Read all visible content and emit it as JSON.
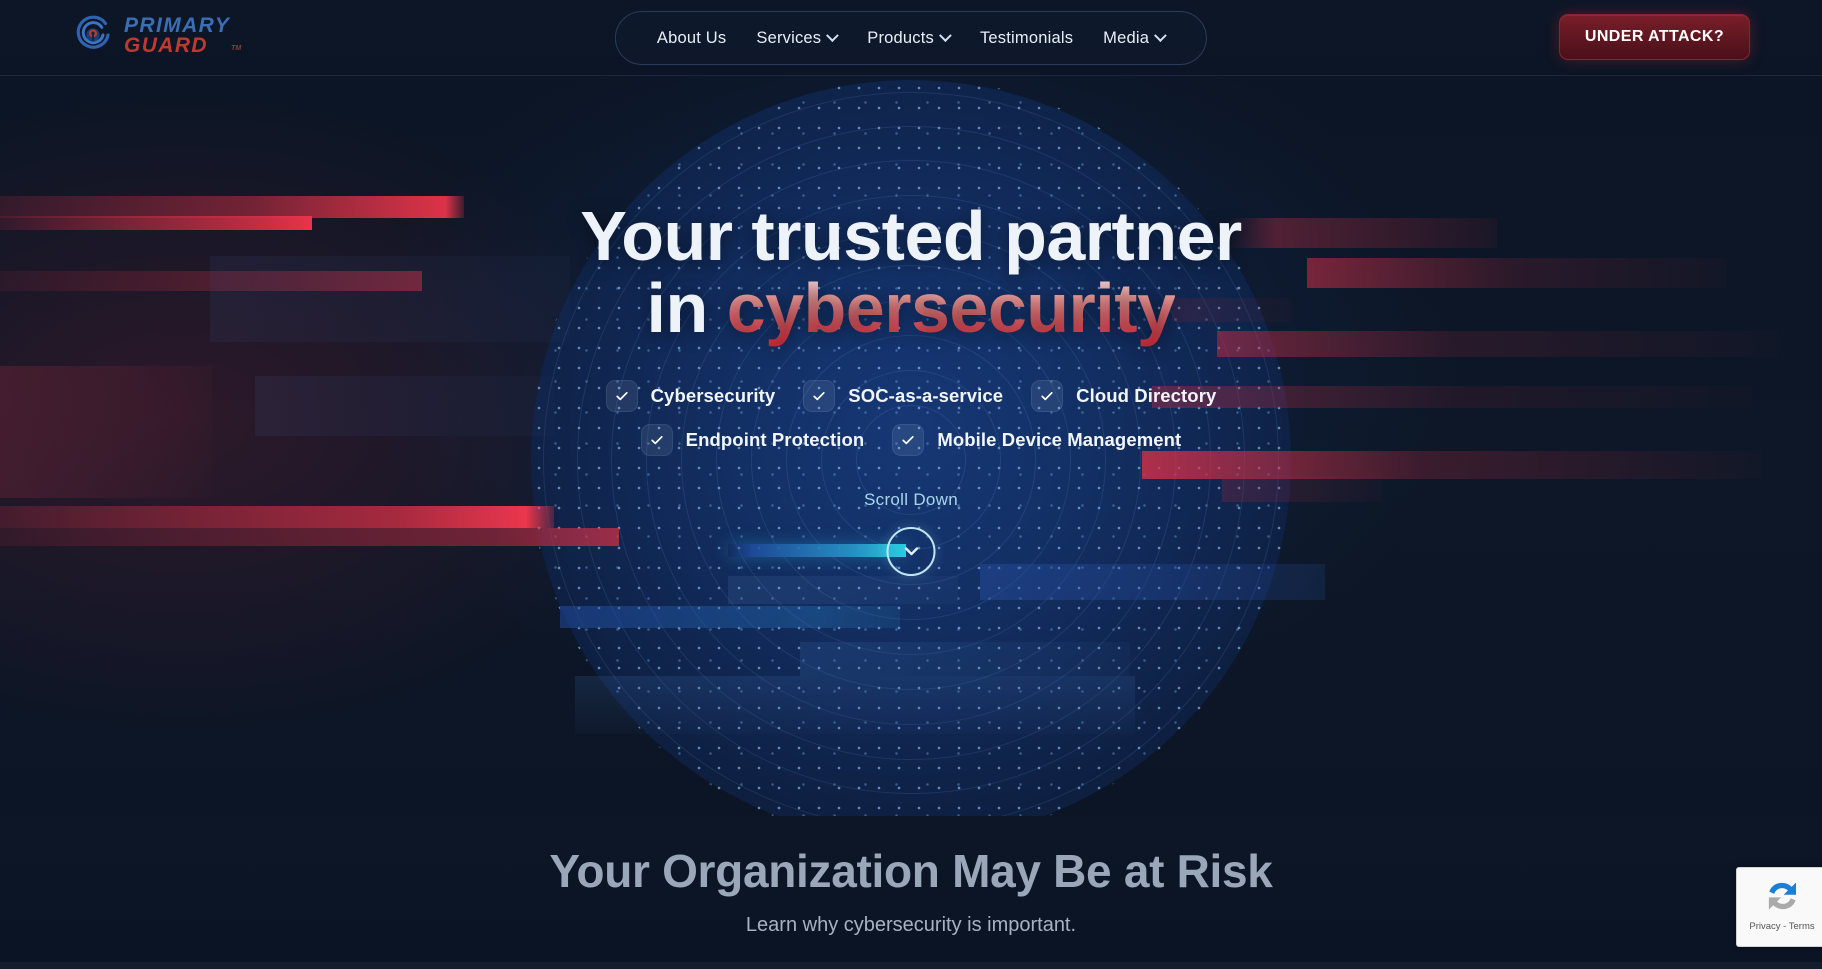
{
  "header": {
    "logo": {
      "line1": "PRIMARY",
      "line2": "GUARD",
      "tm": "TM",
      "icon": "shield-target-icon"
    },
    "nav": [
      {
        "label": "About Us",
        "has_dropdown": false
      },
      {
        "label": "Services",
        "has_dropdown": true
      },
      {
        "label": "Products",
        "has_dropdown": true
      },
      {
        "label": "Testimonials",
        "has_dropdown": false
      },
      {
        "label": "Media",
        "has_dropdown": true
      }
    ],
    "cta": {
      "label": "UNDER ATTACK?",
      "color": "#6b1b27"
    }
  },
  "hero": {
    "headline_line1": "Your trusted partner",
    "headline_line2_prefix": "in ",
    "headline_line2_accent": "cybersecurity",
    "accent_color": "#e4545d",
    "features_row1": [
      {
        "label": "Cybersecurity"
      },
      {
        "label": "SOC-as-a-service"
      },
      {
        "label": "Cloud Directory"
      }
    ],
    "features_row2": [
      {
        "label": "Endpoint Protection"
      },
      {
        "label": "Mobile Device Management"
      }
    ],
    "scroll": {
      "label": "Scroll Down",
      "icon": "chevron-down-icon",
      "progress_color": "#28cde1"
    }
  },
  "risk_section": {
    "title": "Your Organization May Be at Risk",
    "subtitle": "Learn why cybersecurity is important."
  },
  "recaptcha": {
    "icon": "recaptcha-icon",
    "terms": "Privacy - Terms"
  }
}
